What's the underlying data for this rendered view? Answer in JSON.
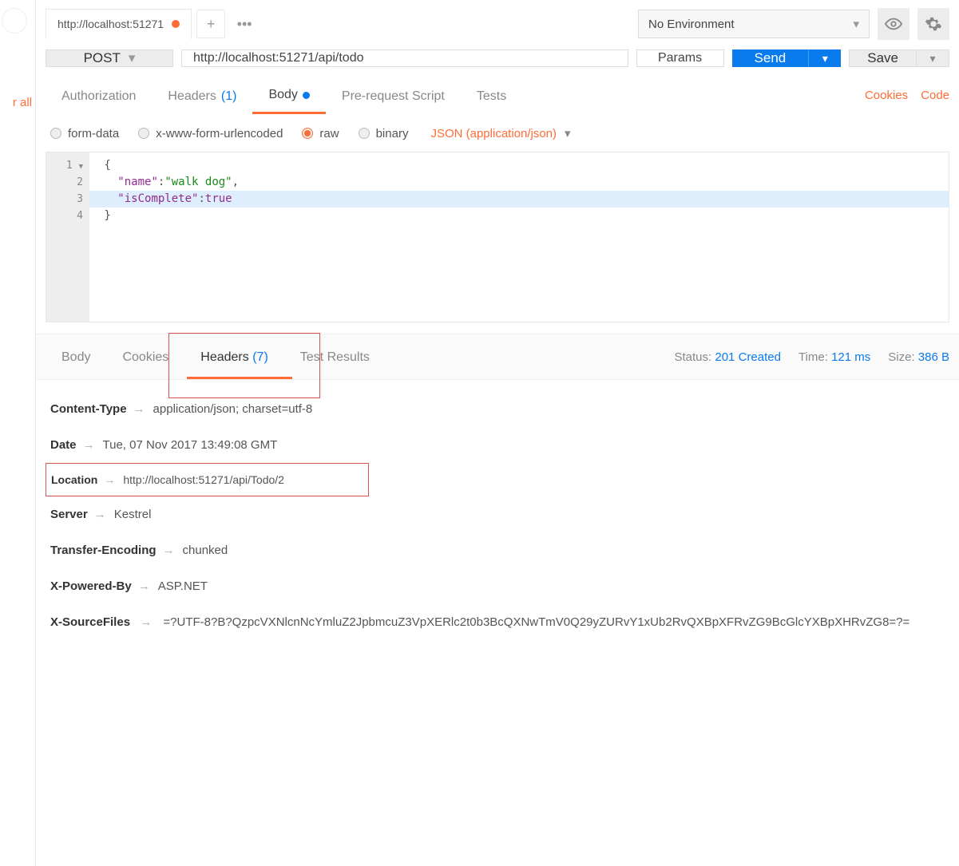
{
  "sidebar": {
    "link_text": "r all"
  },
  "tab": {
    "title": "http://localhost:51271",
    "unsaved": true
  },
  "environment": {
    "selected": "No Environment"
  },
  "request": {
    "method": "POST",
    "url": "http://localhost:51271/api/todo",
    "params_label": "Params",
    "send_label": "Send",
    "save_label": "Save"
  },
  "request_tabs": {
    "authorization": "Authorization",
    "headers": "Headers",
    "headers_count": "(1)",
    "body": "Body",
    "prerequest": "Pre-request Script",
    "tests": "Tests",
    "cookies_link": "Cookies",
    "code_link": "Code"
  },
  "body_types": {
    "form_data": "form-data",
    "urlencoded": "x-www-form-urlencoded",
    "raw": "raw",
    "binary": "binary",
    "content_type": "JSON (application/json)"
  },
  "body_code": {
    "lines": [
      "1",
      "2",
      "3",
      "4"
    ],
    "json_key_name": "\"name\"",
    "json_val_name": "\"walk dog\"",
    "json_key_iscomplete": "\"isComplete\"",
    "json_val_iscomplete": "true"
  },
  "response_tabs": {
    "body": "Body",
    "cookies": "Cookies",
    "headers": "Headers",
    "headers_count": "(7)",
    "test_results": "Test Results"
  },
  "response_meta": {
    "status_label": "Status:",
    "status_value": "201 Created",
    "time_label": "Time:",
    "time_value": "121 ms",
    "size_label": "Size:",
    "size_value": "386 B"
  },
  "response_headers": [
    {
      "name": "Content-Type",
      "value": "application/json; charset=utf-8"
    },
    {
      "name": "Date",
      "value": "Tue, 07 Nov 2017 13:49:08 GMT"
    },
    {
      "name": "Location",
      "value": "http://localhost:51271/api/Todo/2"
    },
    {
      "name": "Server",
      "value": "Kestrel"
    },
    {
      "name": "Transfer-Encoding",
      "value": "chunked"
    },
    {
      "name": "X-Powered-By",
      "value": "ASP.NET"
    },
    {
      "name": "X-SourceFiles",
      "value": "=?UTF-8?B?QzpcVXNlcnNcYmluZ2JpbmcuZ3VpXERlc2t0b3BcQXNwTmV0Q29yZURvY1xUb2RvQXBpXFRvZG9BcGlcYXBpXHRvZG8=?="
    }
  ]
}
